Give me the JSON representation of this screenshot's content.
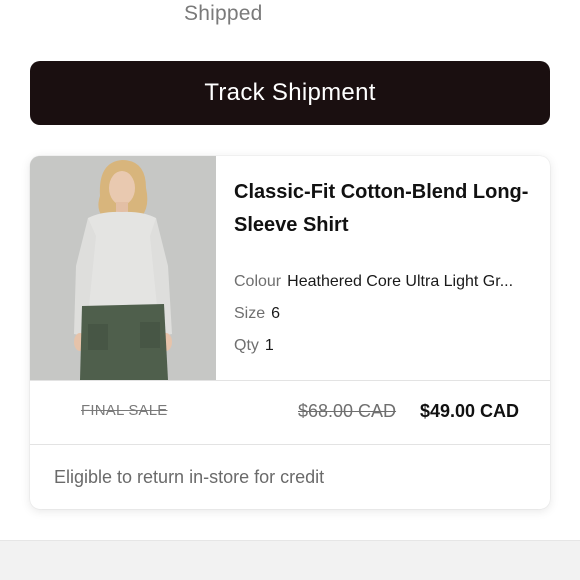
{
  "order": {
    "status": "Shipped",
    "track_label": "Track Shipment"
  },
  "item": {
    "name": "Classic-Fit Cotton-Blend Long-Sleeve Shirt",
    "colour_label": "Colour",
    "colour_value": "Heathered Core Ultra Light Gr...",
    "size_label": "Size",
    "size_value": "6",
    "qty_label": "Qty",
    "qty_value": "1",
    "sale_tag": "FINAL SALE",
    "original_price": "$68.00 CAD",
    "sale_price": "$49.00 CAD",
    "return_note": "Eligible to return in-store for credit"
  },
  "colors": {
    "button_bg": "#1a0f10",
    "image_bg": "#c6c7c5",
    "shirt": "#e4e4e2",
    "pants": "#4f5f4c"
  }
}
